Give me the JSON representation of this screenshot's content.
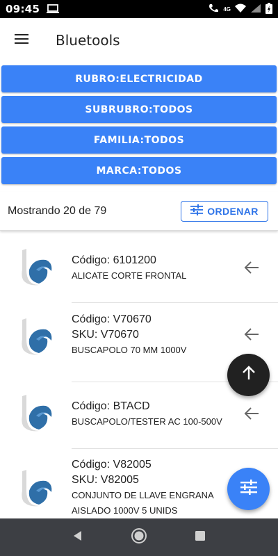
{
  "status": {
    "time": "09:45",
    "network": "4G"
  },
  "app": {
    "title": "Bluetools"
  },
  "filters": [
    {
      "label": "RUBRO:ELECTRICIDAD"
    },
    {
      "label": "SUBRUBRO:TODOS"
    },
    {
      "label": "FAMILIA:TODOS"
    },
    {
      "label": "MARCA:TODOS"
    }
  ],
  "summary": {
    "text": "Mostrando 20 de 79",
    "order_label": "ORDENAR"
  },
  "items": [
    {
      "code": "Código: 6101200",
      "sku": "",
      "desc1": "ALICATE CORTE FRONTAL",
      "desc2": ""
    },
    {
      "code": "Código: V70670",
      "sku": "SKU: V70670",
      "desc1": "BUSCAPOLO 70 MM 1000V",
      "desc2": ""
    },
    {
      "code": "Código: BTACD",
      "sku": "",
      "desc1": "BUSCAPOLO/TESTER AC 100-500V",
      "desc2": ""
    },
    {
      "code": "Código: V82005",
      "sku": "SKU: V82005",
      "desc1": "CONJUNTO DE LLAVE ENGRANA",
      "desc2": "AISLADO 1000V 5 UNIDS"
    }
  ],
  "colors": {
    "primary": "#3a82f7",
    "fab_dark": "#212121",
    "nav_bar": "#3d3f44"
  },
  "icons": {
    "menu": "menu-icon",
    "order": "tune-icon",
    "item_action": "arrow-left-icon",
    "scroll_top": "arrow-up-icon",
    "filter": "tune-icon"
  }
}
